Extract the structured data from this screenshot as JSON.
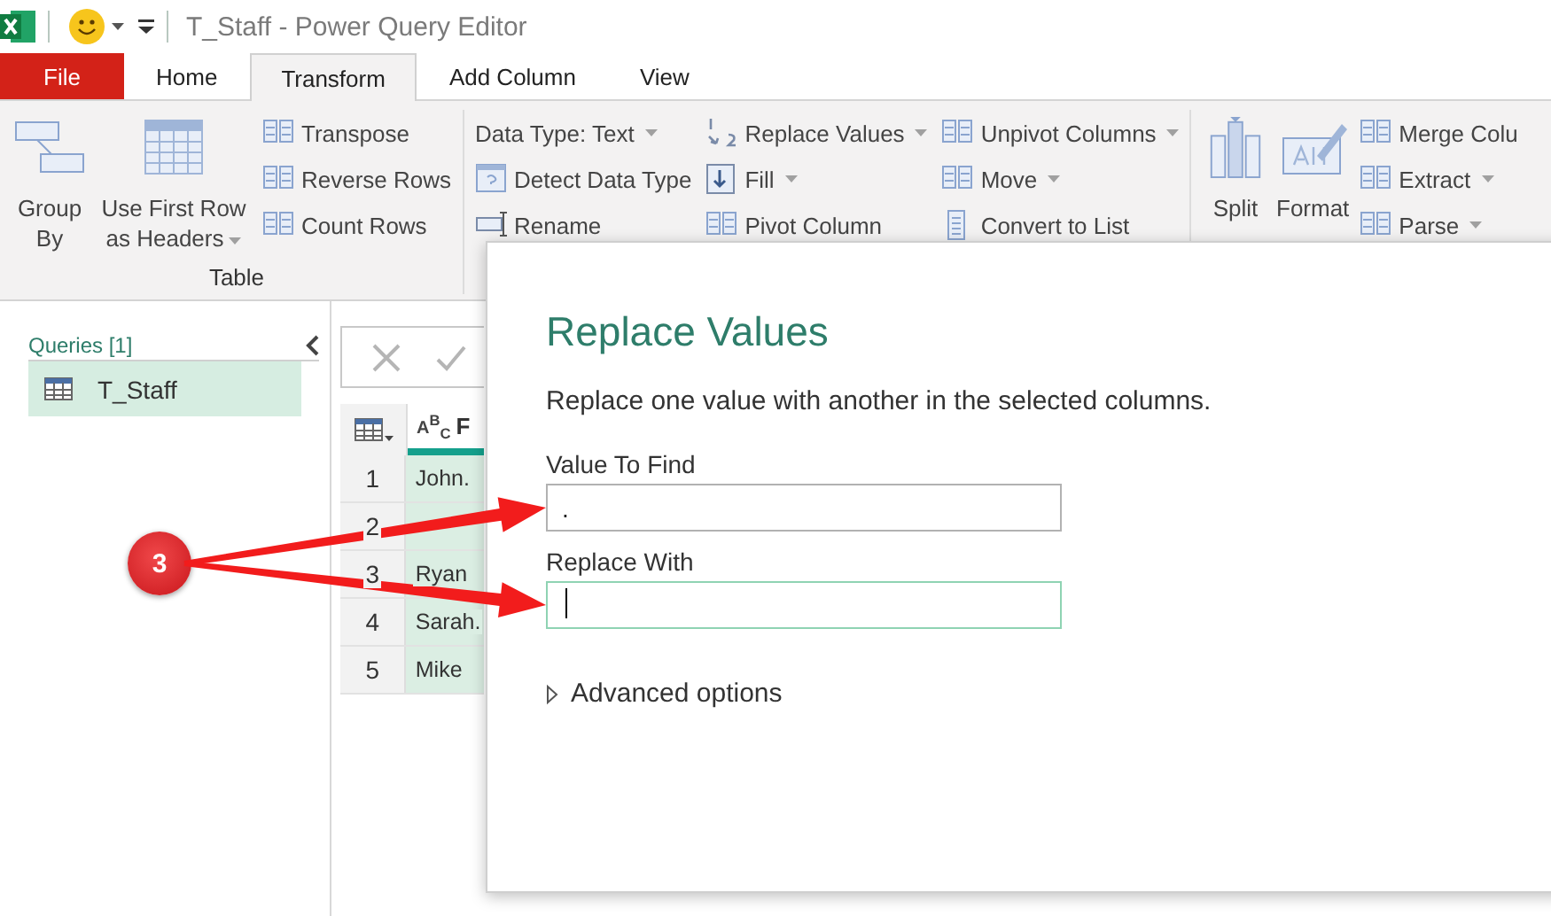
{
  "window": {
    "title": "T_Staff - Power Query Editor"
  },
  "tabs": [
    {
      "label": "File",
      "kind": "file",
      "selected": false
    },
    {
      "label": "Home",
      "kind": "tab",
      "selected": false
    },
    {
      "label": "Transform",
      "kind": "tab",
      "selected": true
    },
    {
      "label": "Add Column",
      "kind": "tab",
      "selected": false
    },
    {
      "label": "View",
      "kind": "tab",
      "selected": false
    }
  ],
  "ribbon": {
    "groups": [
      {
        "label": "Table",
        "columns": [
          {
            "kind": "large",
            "label": "Group By",
            "dropdown": false
          },
          {
            "kind": "large",
            "label": "Use First Row as Headers",
            "dropdown": true
          },
          {
            "kind": "stack",
            "items": [
              {
                "label": "Transpose",
                "dropdown": false
              },
              {
                "label": "Reverse Rows",
                "dropdown": false
              },
              {
                "label": "Count Rows",
                "dropdown": false
              }
            ]
          }
        ]
      },
      {
        "columns": [
          {
            "kind": "stack",
            "items": [
              {
                "label": "Data Type: Text",
                "dropdown": true
              },
              {
                "label": "Detect Data Type",
                "dropdown": false
              },
              {
                "label": "Rename",
                "dropdown": false
              }
            ]
          },
          {
            "kind": "stack",
            "items": [
              {
                "label": "Replace Values",
                "dropdown": true
              },
              {
                "label": "Fill",
                "dropdown": true
              },
              {
                "label": "Pivot Column",
                "dropdown": false
              }
            ]
          },
          {
            "kind": "stack",
            "items": [
              {
                "label": "Unpivot Columns",
                "dropdown": true
              },
              {
                "label": "Move",
                "dropdown": true
              },
              {
                "label": "Convert to List",
                "dropdown": false
              }
            ]
          }
        ]
      },
      {
        "columns": [
          {
            "kind": "large",
            "label": "Split",
            "dropdown": false
          },
          {
            "kind": "large",
            "label": "Format",
            "dropdown": false
          },
          {
            "kind": "stack",
            "items": [
              {
                "label": "Merge Colu",
                "dropdown": false
              },
              {
                "label": "Extract",
                "dropdown": true
              },
              {
                "label": "Parse",
                "dropdown": true
              }
            ]
          }
        ]
      }
    ]
  },
  "queries": {
    "title": "Queries [1]",
    "items": [
      {
        "label": "T_Staff",
        "selected": true
      }
    ]
  },
  "table": {
    "columns": [
      {
        "type": "A$^{B}$$_{C}$",
        "name": "F",
        "selected": true
      }
    ],
    "rows": [
      {
        "number": "1",
        "cells": [
          "John."
        ]
      },
      {
        "number": "2"
      },
      {
        "number": "3",
        "cells": [
          "Ryan"
        ]
      },
      {
        "number": "4",
        "cells": [
          "Sarah."
        ]
      },
      {
        "number": "5",
        "cells": [
          "Mike"
        ]
      }
    ]
  },
  "dialog": {
    "title": "Replace Values",
    "description": "Replace one value with another in the selected columns.",
    "fields": [
      {
        "label": "Value To Find",
        "value": ".",
        "focused": false
      },
      {
        "label": "Replace With",
        "focused": true
      }
    ],
    "advanced": {
      "label": "Advanced options",
      "expanded": false
    }
  },
  "callout": {
    "label": "3"
  }
}
